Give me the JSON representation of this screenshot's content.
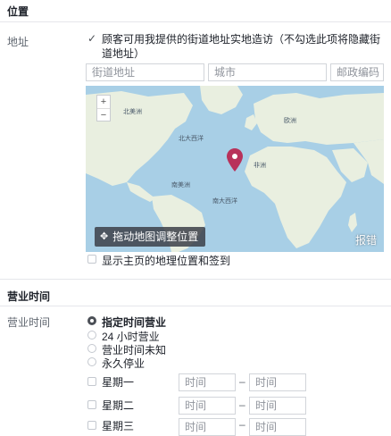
{
  "location": {
    "section_title": "位置",
    "address_label": "地址",
    "visit_checkbox_text_line1": "顾客可用我提供的街道地址实地造访（不勾选此项将隐藏街",
    "visit_checkbox_text_line2": "道地址）",
    "street_placeholder": "街道地址",
    "city_placeholder": "城市",
    "zip_placeholder": "邮政编码",
    "map": {
      "zoom_in": "+",
      "zoom_out": "−",
      "labels": {
        "north_america": "北美洲",
        "europe": "欧洲",
        "atlantic": "北大西洋",
        "africa": "非洲",
        "south_america": "南美洲",
        "south_atlantic": "南大西洋"
      },
      "drag_button": "拖动地图调整位置",
      "report_link": "报错"
    },
    "show_checkin_text": "显示主页的地理位置和签到"
  },
  "hours": {
    "section_title": "营业时间",
    "label": "营业时间",
    "options": [
      "指定时间营业",
      "24 小时营业",
      "营业时间未知",
      "永久停业"
    ],
    "selected_index": 0,
    "days": [
      {
        "name": "星期一",
        "open_placeholder": "时间",
        "close_placeholder": "时间"
      },
      {
        "name": "星期二",
        "open_placeholder": "时间",
        "close_placeholder": "时间"
      },
      {
        "name": "星期三",
        "open_placeholder": "时间",
        "close_placeholder": "时间"
      }
    ],
    "range_separator": "–"
  },
  "colors": {
    "ocean": "#a8cfe6",
    "land": "#e9efe0",
    "pin": "#b8325a"
  }
}
